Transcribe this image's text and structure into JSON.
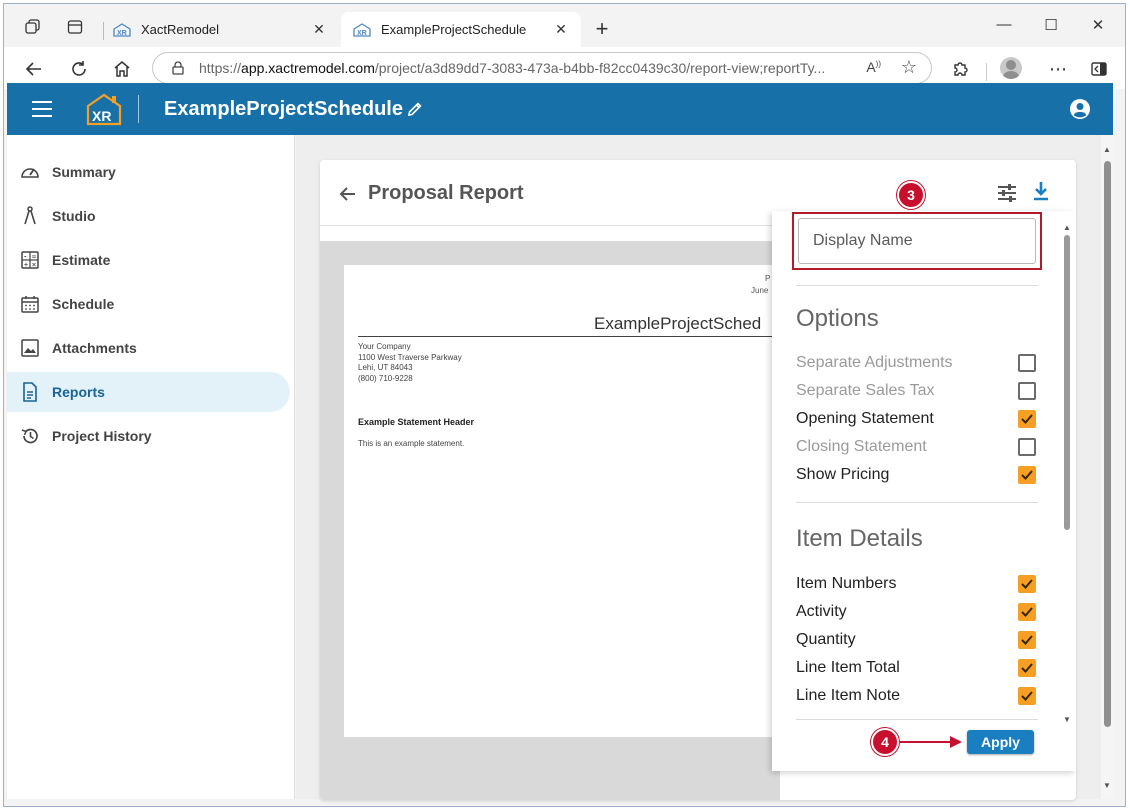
{
  "browser": {
    "tabs": [
      {
        "label": "XactRemodel",
        "active": false
      },
      {
        "label": "ExampleProjectSchedule",
        "active": true
      }
    ],
    "url_prefix": "https://",
    "url_host": "app.xactremodel.com",
    "url_path": "/project/a3d89dd7-3083-473a-b4bb-f82cc0439c30/report-view;reportTy..."
  },
  "app": {
    "project_title": "ExampleProjectSchedule"
  },
  "sidebar": {
    "items": [
      {
        "label": "Summary",
        "icon": "speedometer-icon",
        "active": false
      },
      {
        "label": "Studio",
        "icon": "compass-icon",
        "active": false
      },
      {
        "label": "Estimate",
        "icon": "calculator-icon",
        "active": false
      },
      {
        "label": "Schedule",
        "icon": "calendar-icon",
        "active": false
      },
      {
        "label": "Attachments",
        "icon": "image-icon",
        "active": false
      },
      {
        "label": "Reports",
        "icon": "document-icon",
        "active": true
      },
      {
        "label": "Project History",
        "icon": "history-icon",
        "active": false
      }
    ]
  },
  "report": {
    "title": "Proposal Report",
    "preview": {
      "page_label": "P",
      "date_label": "June",
      "doc_title": "ExampleProjectSched",
      "company": {
        "name": "Your Company",
        "address1": "1100 West Traverse Parkway",
        "address2": "Lehi, UT 84043",
        "phone": "(800) 710-9228"
      },
      "statement_header": "Example Statement Header",
      "statement_text": "This is an example statement."
    }
  },
  "panel": {
    "display_name_placeholder": "Display Name",
    "options_title": "Options",
    "options": [
      {
        "label": "Separate Adjustments",
        "checked": false,
        "enabled": false
      },
      {
        "label": "Separate Sales Tax",
        "checked": false,
        "enabled": false
      },
      {
        "label": "Opening Statement",
        "checked": true,
        "enabled": true
      },
      {
        "label": "Closing Statement",
        "checked": false,
        "enabled": false
      },
      {
        "label": "Show Pricing",
        "checked": true,
        "enabled": true
      }
    ],
    "item_details_title": "Item Details",
    "item_details": [
      {
        "label": "Item Numbers",
        "checked": true
      },
      {
        "label": "Activity",
        "checked": true
      },
      {
        "label": "Quantity",
        "checked": true
      },
      {
        "label": "Line Item Total",
        "checked": true
      },
      {
        "label": "Line Item Note",
        "checked": true
      }
    ],
    "apply_label": "Apply"
  },
  "callouts": {
    "step3": "3",
    "step4": "4"
  },
  "colors": {
    "app_bar": "#1770a8",
    "accent": "#1a7fc1",
    "checkbox": "#f5a025",
    "callout": "#c8102e"
  }
}
